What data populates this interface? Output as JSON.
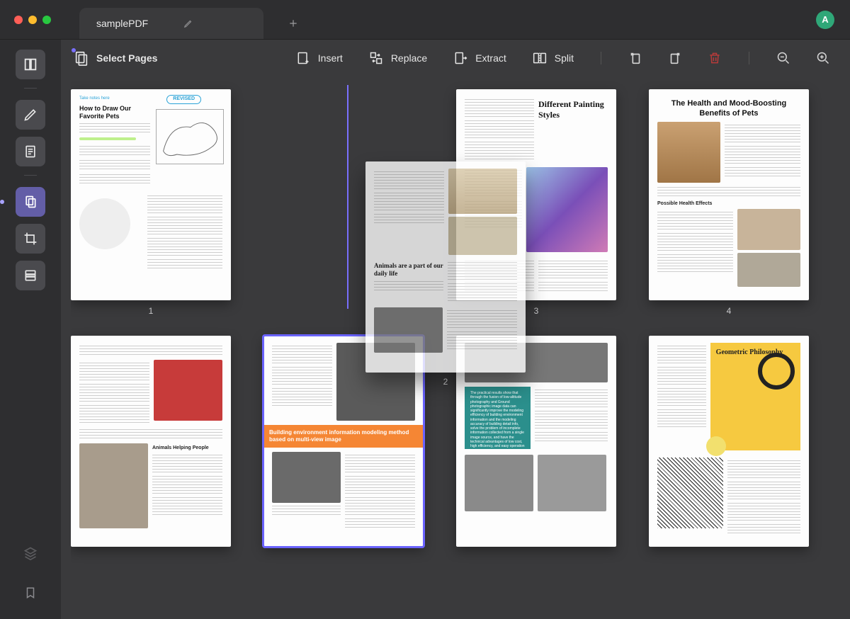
{
  "window": {
    "tab_title": "samplePDF",
    "avatar_initial": "A"
  },
  "actions": {
    "select_pages": "Select Pages",
    "insert": "Insert",
    "replace": "Replace",
    "extract": "Extract",
    "split": "Split"
  },
  "pages": {
    "p1": {
      "num": "1",
      "badge": "REVISED",
      "note": "Take notes here",
      "title": "How to Draw Our Favorite Pets"
    },
    "p2": {
      "num": "2",
      "title": "Animals are a part of our daily life"
    },
    "p3": {
      "num": "3",
      "title": "Different Painting Styles"
    },
    "p4": {
      "num": "4",
      "title": "The Health and Mood-Boosting Benefits of Pets",
      "sub": "Possible Health Effects"
    },
    "p5": {
      "title": "Animals Helping People"
    },
    "p6": {
      "band": "Building environment information modeling method based on multi-view image"
    },
    "p7": {
      "teal_text": "The practical results show that through the fusion of low-altitude photography and Ground photographic image data can significantly improve the modeling efficiency of building environment information and the modeling accuracy of building detail info, solve the problem of incomplete information collected from a single image source, and have the technical advantages of low cost, high efficiency, and easy operation"
    },
    "p8": {
      "title": "Geometric Philosophy"
    }
  }
}
